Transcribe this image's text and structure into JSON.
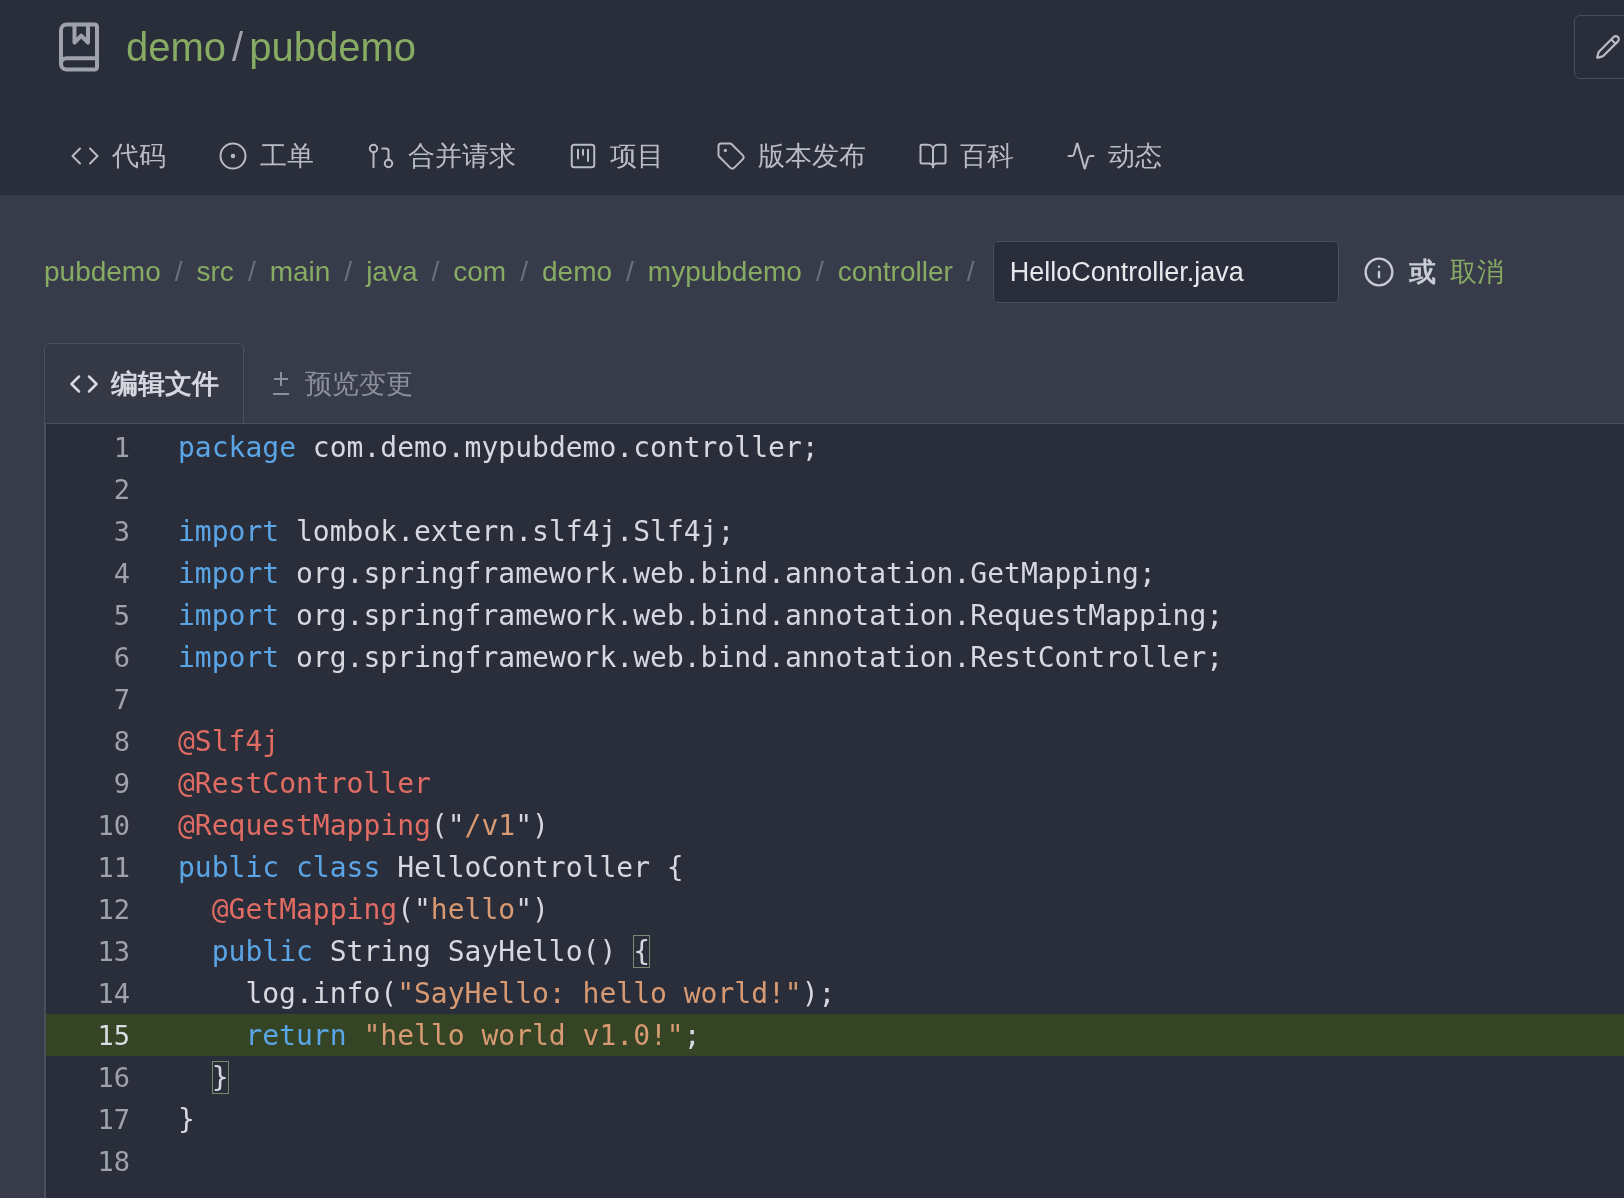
{
  "repo": {
    "owner": "demo",
    "separator": "/",
    "name": "pubdemo"
  },
  "nav": [
    {
      "kind": "code",
      "label": "代码"
    },
    {
      "kind": "issues",
      "label": "工单"
    },
    {
      "kind": "pulls",
      "label": "合并请求"
    },
    {
      "kind": "projects",
      "label": "项目"
    },
    {
      "kind": "releases",
      "label": "版本发布"
    },
    {
      "kind": "wiki",
      "label": "百科"
    },
    {
      "kind": "activity",
      "label": "动态"
    }
  ],
  "breadcrumb": [
    {
      "kind": "link",
      "text": "pubdemo"
    },
    {
      "kind": "separator",
      "text": "/"
    },
    {
      "kind": "link",
      "text": "src"
    },
    {
      "kind": "separator",
      "text": "/"
    },
    {
      "kind": "link",
      "text": "main"
    },
    {
      "kind": "separator",
      "text": "/"
    },
    {
      "kind": "link",
      "text": "java"
    },
    {
      "kind": "separator",
      "text": "/"
    },
    {
      "kind": "link",
      "text": "com"
    },
    {
      "kind": "separator",
      "text": "/"
    },
    {
      "kind": "link",
      "text": "demo"
    },
    {
      "kind": "separator",
      "text": "/"
    },
    {
      "kind": "link",
      "text": "mypubdemo"
    },
    {
      "kind": "separator",
      "text": "/"
    },
    {
      "kind": "link",
      "text": "controller"
    },
    {
      "kind": "separator",
      "text": "/"
    }
  ],
  "filename": {
    "value": "HelloController.java"
  },
  "or_text": "或",
  "cancel": "取消",
  "tabs": [
    {
      "kind": "edit",
      "label": "编辑文件",
      "selected": true
    },
    {
      "kind": "preview",
      "label": "预览变更",
      "selected": false
    }
  ],
  "lines": [
    {
      "number": "1",
      "active": false,
      "tokens": [
        {
          "kind": "keyword",
          "text": "package"
        },
        {
          "kind": "plain",
          "text": " com.demo.mypubdemo.controller;"
        }
      ]
    },
    {
      "number": "2",
      "active": false
    },
    {
      "number": "3",
      "active": false,
      "tokens": [
        {
          "kind": "keyword",
          "text": "import"
        },
        {
          "kind": "plain",
          "text": " lombok.extern.slf4j.Slf4j;"
        }
      ]
    },
    {
      "number": "4",
      "active": false,
      "tokens": [
        {
          "kind": "keyword",
          "text": "import"
        },
        {
          "kind": "plain",
          "text": " org.springframework.web.bind.annotation.GetMapping;"
        }
      ]
    },
    {
      "number": "5",
      "active": false,
      "tokens": [
        {
          "kind": "keyword",
          "text": "import"
        },
        {
          "kind": "plain",
          "text": " org.springframework.web.bind.annotation.RequestMapping;"
        }
      ]
    },
    {
      "number": "6",
      "active": false,
      "tokens": [
        {
          "kind": "keyword",
          "text": "import"
        },
        {
          "kind": "plain",
          "text": " org.springframework.web.bind.annotation.RestController;"
        }
      ]
    },
    {
      "number": "7",
      "active": false
    },
    {
      "number": "8",
      "active": false,
      "tokens": [
        {
          "kind": "annotation",
          "text": "@Slf4j"
        }
      ]
    },
    {
      "number": "9",
      "active": false,
      "tokens": [
        {
          "kind": "annotation",
          "text": "@RestController"
        }
      ]
    },
    {
      "number": "10",
      "active": false,
      "tokens": [
        {
          "kind": "annotation",
          "text": "@RequestMapping"
        },
        {
          "kind": "plain",
          "text": "(\""
        },
        {
          "kind": "string",
          "text": "/v1"
        },
        {
          "kind": "plain",
          "text": "\")"
        }
      ]
    },
    {
      "number": "11",
      "active": false,
      "tokens": [
        {
          "kind": "keyword",
          "text": "public class"
        },
        {
          "kind": "plain",
          "text": " HelloController {"
        }
      ]
    },
    {
      "number": "12",
      "active": false,
      "tokens": [
        {
          "kind": "indent"
        },
        {
          "kind": "annotation",
          "text": "@GetMapping"
        },
        {
          "kind": "plain",
          "text": "(\""
        },
        {
          "kind": "string",
          "text": "hello"
        },
        {
          "kind": "plain",
          "text": "\")"
        }
      ]
    },
    {
      "number": "13",
      "active": false,
      "tokens": [
        {
          "kind": "indent"
        },
        {
          "kind": "keyword",
          "text": "public"
        },
        {
          "kind": "plain",
          "text": " String SayHello() "
        },
        {
          "kind": "bracket",
          "text": "{"
        }
      ]
    },
    {
      "number": "14",
      "active": false,
      "tokens": [
        {
          "kind": "indent"
        },
        {
          "kind": "indent"
        },
        {
          "kind": "plain",
          "text": "log.info("
        },
        {
          "kind": "string",
          "text": "\"SayHello: hello world!\""
        },
        {
          "kind": "plain",
          "text": ");"
        }
      ]
    },
    {
      "number": "15",
      "active": true,
      "tokens": [
        {
          "kind": "indent"
        },
        {
          "kind": "indent"
        },
        {
          "kind": "keyword",
          "text": "return"
        },
        {
          "kind": "string",
          "text": " \"hello world v1.0!\""
        },
        {
          "kind": "plain",
          "text": ";"
        }
      ]
    },
    {
      "number": "16",
      "active": false,
      "tokens": [
        {
          "kind": "indent"
        },
        {
          "kind": "bracket",
          "text": "}"
        }
      ]
    },
    {
      "number": "17",
      "active": false,
      "tokens": [
        {
          "kind": "plain",
          "text": "}"
        }
      ]
    },
    {
      "number": "18",
      "active": false
    }
  ]
}
